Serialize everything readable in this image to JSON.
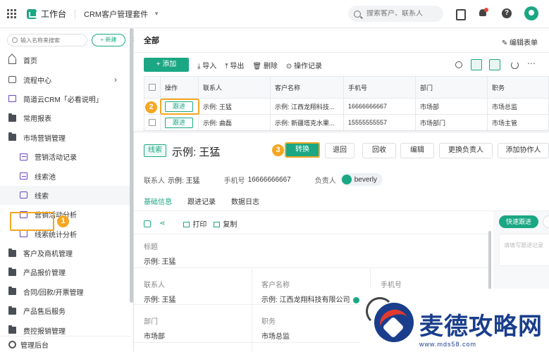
{
  "topbar": {
    "app_title": "工作台",
    "suite": "CRM客户管理套件",
    "search_placeholder": "搜索客户、联系人"
  },
  "sidebar": {
    "search_placeholder": "输入名称来搜索",
    "new_label": "+ 新建",
    "items": [
      {
        "label": "首页",
        "icon": "home-icon"
      },
      {
        "label": "流程中心",
        "icon": "flow-icon"
      },
      {
        "label": "简道云CRM「必看说明」",
        "icon": "doc-icon"
      },
      {
        "label": "常用报表",
        "icon": "folder-icon"
      },
      {
        "label": "市场营销管理",
        "icon": "folder-icon"
      },
      {
        "label": "营销活动记录",
        "icon": "form-icon"
      },
      {
        "label": "线索池",
        "icon": "form-icon"
      },
      {
        "label": "线索",
        "icon": "lead-icon"
      },
      {
        "label": "营销活动分析",
        "icon": "chart-icon"
      },
      {
        "label": "线索统计分析",
        "icon": "chart-icon"
      },
      {
        "label": "客户及商机管理",
        "icon": "folder-icon"
      },
      {
        "label": "产品报价管理",
        "icon": "folder-icon"
      },
      {
        "label": "合同/回款/开票管理",
        "icon": "folder-icon"
      },
      {
        "label": "产品售后服务",
        "icon": "folder-icon"
      },
      {
        "label": "费控报销管理",
        "icon": "folder-icon"
      }
    ],
    "footer": "管理后台"
  },
  "markers": {
    "m1": "1",
    "m2": "2",
    "m3": "3"
  },
  "main": {
    "title": "全部",
    "edit_form": "编辑表单",
    "toolbar": {
      "add": "+ 添加",
      "import": "导入",
      "export": "导出",
      "delete": "删除",
      "log": "操作记录"
    },
    "table": {
      "headers": [
        "操作",
        "联系人",
        "客户名称",
        "手机号",
        "部门",
        "职务"
      ],
      "rows": [
        {
          "action": "跟进",
          "contact": "示例: 王猛",
          "customer": "示例: 江西龙翔科技...",
          "phone": "16666666667",
          "dept": "市场部",
          "title": "市场总监"
        },
        {
          "action": "跟进",
          "contact": "示例: 曲磊",
          "customer": "示例: 新疆塔克水果...",
          "phone": "15555555557",
          "dept": "市场部门",
          "title": "市场主管"
        }
      ]
    }
  },
  "detail": {
    "tag": "线索",
    "name": "示例: 王猛",
    "buttons": {
      "convert": "转换",
      "return": "退回",
      "recycle": "回收",
      "edit": "编辑",
      "change_owner": "更换负责人",
      "add_collab": "添加协作人"
    },
    "info": {
      "contact_label": "联系人",
      "contact_value": "示例: 王猛",
      "phone_label": "手机号",
      "phone_value": "16666666667",
      "owner_label": "负责人",
      "owner_value": "beverly"
    },
    "tabs": [
      "基础信息",
      "跟进记录",
      "数据日志"
    ],
    "actions": {
      "print": "打印",
      "copy": "复制"
    },
    "fields": {
      "title_label": "标题",
      "title_value": "示例: 王猛",
      "contact_label": "联系人",
      "contact_value": "示例: 王猛",
      "customer_label": "客户名称",
      "customer_value": "示例: 江西龙翔科技有限公司",
      "phone_label": "手机号",
      "dept_label": "部门",
      "dept_value": "市场部",
      "position_label": "职务",
      "position_value": "市场总监"
    },
    "quick_follow": "快速跟进",
    "follow_placeholder": "请填写跟进记录"
  },
  "watermark": {
    "text": "麦德攻略网",
    "url": "www.mds58.com"
  },
  "colors": {
    "accent": "#1ba784",
    "marker": "#f5a623",
    "watermark": "#1a3e8c"
  }
}
